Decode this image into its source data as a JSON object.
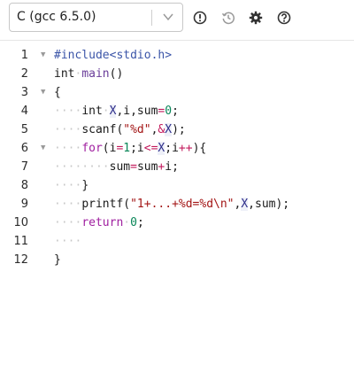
{
  "toolbar": {
    "language_select": {
      "value": "C (gcc 6.5.0)"
    },
    "icons": [
      "exclamation-icon",
      "history-icon",
      "gear-icon",
      "help-icon"
    ]
  },
  "editor": {
    "line_numbers": [
      "1",
      "2",
      "3",
      "4",
      "5",
      "6",
      "7",
      "8",
      "9",
      "10",
      "11",
      "12"
    ],
    "lines": [
      "#include<stdio.h>",
      "int main()",
      "{",
      "    int X,i,sum=0;",
      "    scanf(\"%d\",&X);",
      "    for(i=1;i<=X;i++){",
      "        sum=sum+i;",
      "    }",
      "    printf(\"1+...+%d=%d\\n\",X,sum);",
      "    return 0;",
      "",
      "}"
    ]
  },
  "colors": {
    "preprocessor": "#3b55a8",
    "string": "#a31515",
    "number": "#098658",
    "operator": "#c2185b",
    "control": "#a020a0"
  }
}
